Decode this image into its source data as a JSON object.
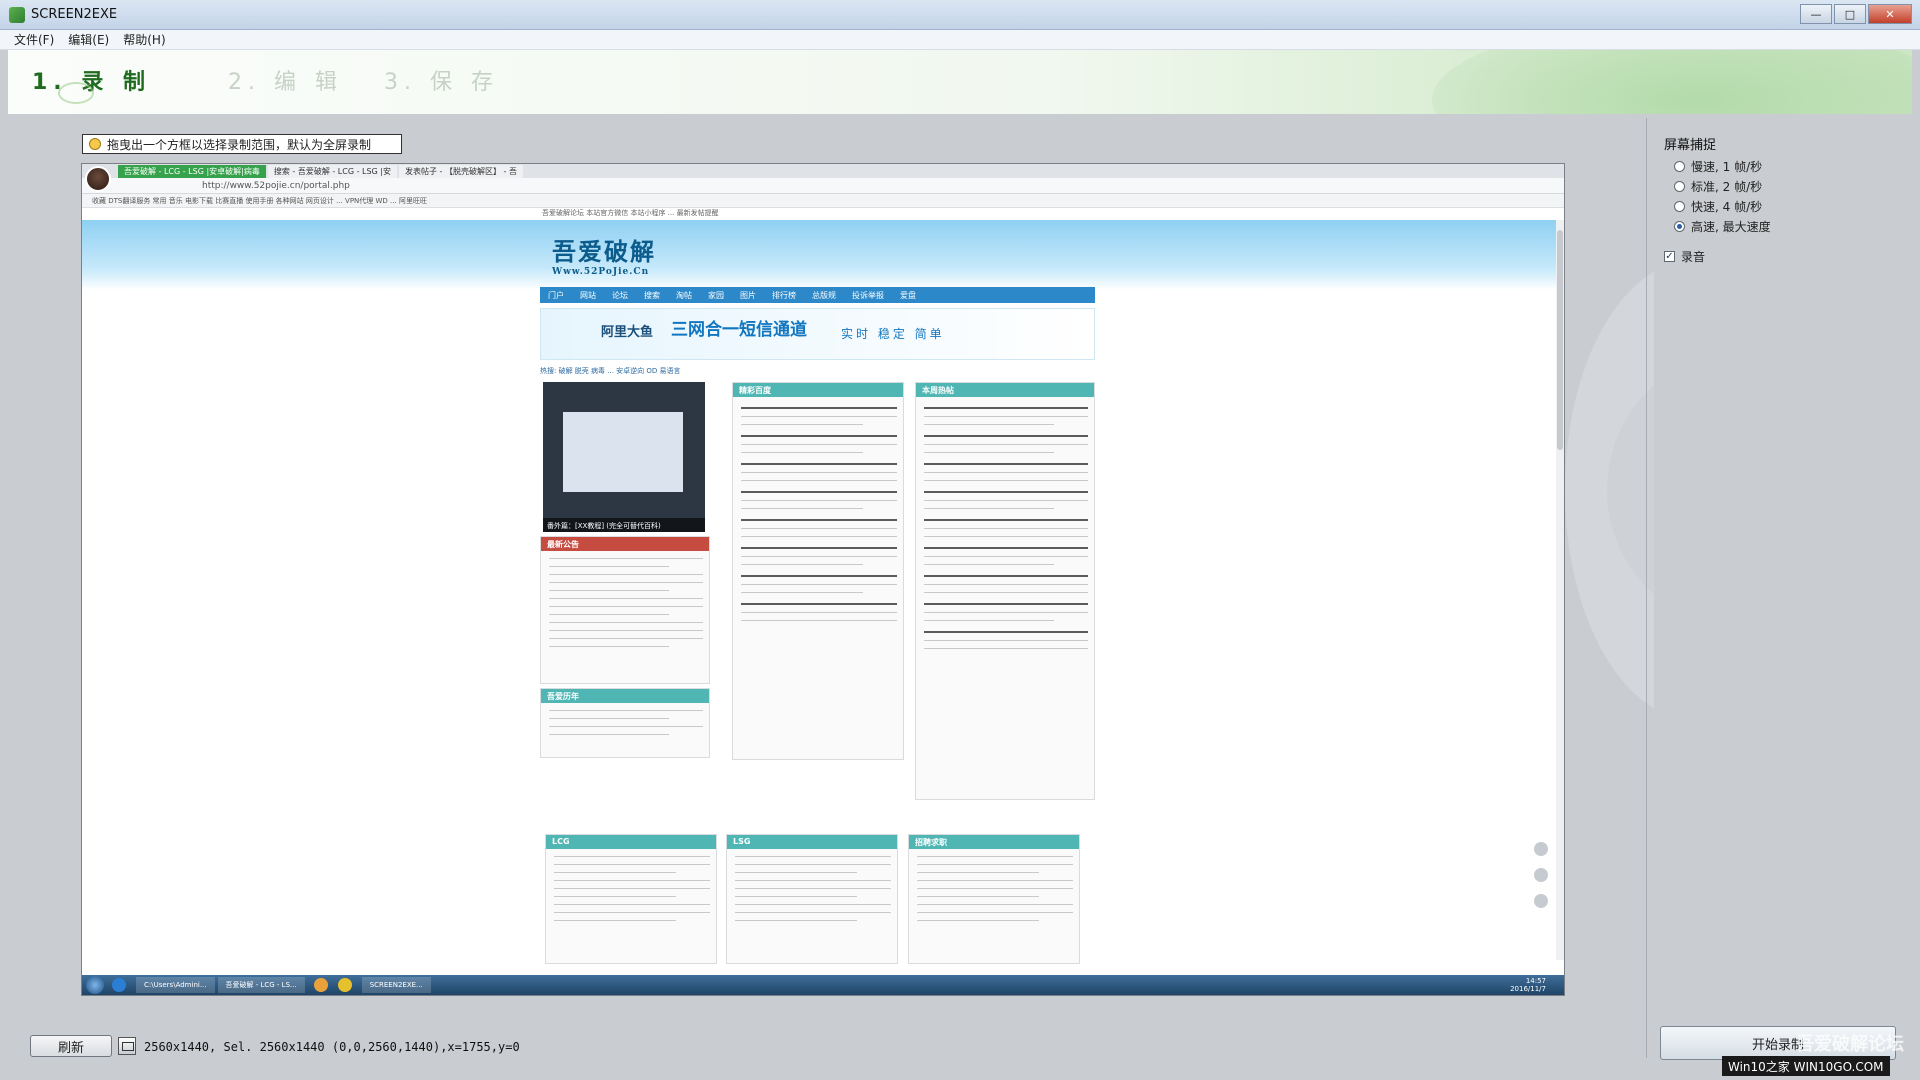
{
  "window": {
    "title": "SCREEN2EXE",
    "buttons": {
      "minimize": "—",
      "maximize": "□",
      "close": "✕"
    }
  },
  "menu": {
    "items": [
      "文件(F)",
      "编辑(E)",
      "帮助(H)"
    ]
  },
  "steps": [
    {
      "label": "1. 录 制",
      "active": true
    },
    {
      "label": "2. 编 辑",
      "active": false
    },
    {
      "label": "3. 保 存",
      "active": false
    }
  ],
  "hint": "拖曳出一个方框以选择录制范围，默认为全屏录制",
  "preview": {
    "tabs": [
      "吾爱破解 - LCG - LSG |安卓破解|病毒",
      "搜索 - 吾爱破解 - LCG - LSG |安",
      "发表帖子 - 【脱壳破解区】 - 吾"
    ],
    "address": "http://www.52pojie.cn/portal.php",
    "favorites": "收藏  DTS翻译服务  常用  音乐  电影下载  比赛直播  使用手册  各种网站  网页设计  ...  VPN代理  WD  ...  阿里旺旺",
    "topline": "吾爱破解论坛  本站官方微信  本站小程序 ...  最新发帖提醒",
    "logo": "吾爱破解",
    "logo_url": "Www.52PoJie.Cn",
    "nav": [
      "门户",
      "网站",
      "论坛",
      "搜索",
      "淘帖",
      "家园",
      "图片",
      "排行榜",
      "总版规",
      "投诉举报",
      "爱盘"
    ],
    "banner": {
      "brand": "阿里大鱼",
      "headline": "三网合一短信通道",
      "slogan": "实时 稳定 简单"
    },
    "search_hot": "热搜: 破解 脱壳 病毒 ...  安卓逆向  OD  易语言",
    "section_titles": [
      "精彩百度",
      "本周热帖",
      "最新公告",
      "吾爱历年",
      "LCG",
      "LSG",
      "招聘求职"
    ],
    "thumb_caption": "番外篇：[XX教程] (完全可替代百科)",
    "taskbar": {
      "apps": [
        "C:\\Users\\Admini...",
        "吾爱破解 - LCG - LS...",
        "SCREEN2EXE..."
      ],
      "clock_time": "14:57",
      "clock_date": "2016/11/7"
    }
  },
  "capture": {
    "title": "屏幕捕捉",
    "options": [
      {
        "label": "慢速, 1 帧/秒",
        "selected": false
      },
      {
        "label": "标准, 2 帧/秒",
        "selected": false
      },
      {
        "label": "快速, 4 帧/秒",
        "selected": false
      },
      {
        "label": "高速, 最大速度",
        "selected": true
      }
    ],
    "record_audio": {
      "label": "录音",
      "checked": true
    }
  },
  "bottom": {
    "refresh_label": "刷新",
    "status": "2560x1440, Sel. 2560x1440 (0,0,2560,1440),x=1755,y=0",
    "start_label": "开始录制",
    "watermark": "吾爱破解论坛",
    "watermark2": "Win10之家 WIN10GO.COM"
  }
}
